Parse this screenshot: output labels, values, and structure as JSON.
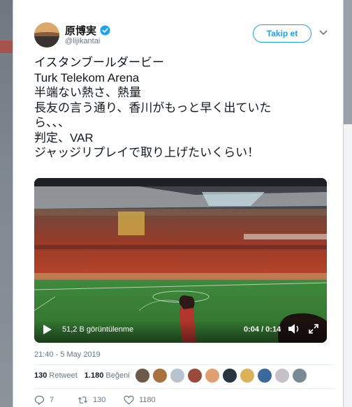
{
  "tweet": {
    "author_name": "原博実",
    "handle": "@lijikantai",
    "follow_label": "Takip et",
    "text_lines": [
      "イスタンブールダービー",
      "Turk Telekom Arena",
      "半端ない熱さ、熱量",
      "長友の言う通り、香川がもっと早く出ていた",
      "ら、、、",
      "判定、VAR",
      "ジャッジリプレイで取り上げたいくらい！"
    ],
    "video": {
      "views": "51,2 B görüntülenme",
      "time": "0:04 / 0:14",
      "progress": 0.29
    },
    "timestamp": "21:40 - 5 May 2019",
    "retweets": {
      "count": "130",
      "label": "Retweet"
    },
    "likes": {
      "count": "1.180",
      "label": "Beğeni"
    },
    "liker_colors": [
      "#6b5a4a",
      "#a8723f",
      "#b7c3cf",
      "#9a4a3a",
      "#e0a070",
      "#2a3540",
      "#d9b25a",
      "#3a6a9a",
      "#c6c1c8",
      "#7a8a94"
    ],
    "actions": {
      "replies": "7",
      "retweets": "130",
      "likes": "1180"
    },
    "accent_color": "#1da1f2"
  }
}
